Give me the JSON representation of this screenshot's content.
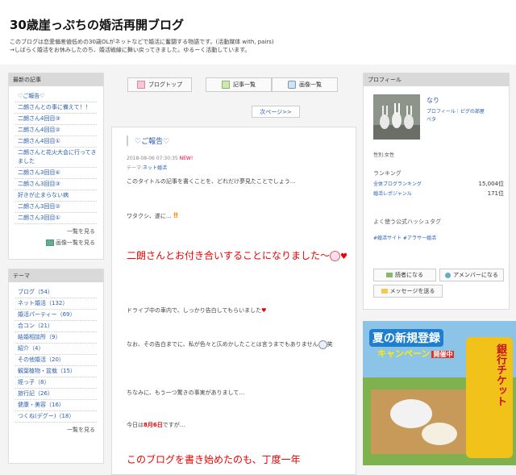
{
  "header": {
    "title": "30歳崖っぷちの婚活再開ブログ",
    "desc_1": "このブログは恋愛偏差値低めの30歳OLがネットなどで婚活に奮闘する物語です。(活動媒体 with, pairs)",
    "desc_2": "→しばらく婚活をお休みしたのち、婚活戦線に舞い戻ってきました。ゆるーく活動しています。"
  },
  "sidebar_recent": {
    "heading": "最新の記事",
    "items": [
      "♡ご報告♡",
      "二朗さんとの事に備えて！！",
      "二朗さん4回目③",
      "二朗さん4回目②",
      "二朗さん4回目①",
      "二朗さんと花火大会に行ってきました",
      "二朗さん3回目④",
      "二朗さん3回目③",
      "好きが止まらない病",
      "二朗さん3回目②",
      "二朗さん3回目①"
    ],
    "more_list": "一覧を見る",
    "more_images": "画像一覧を見る"
  },
  "sidebar_theme": {
    "heading": "テーマ",
    "items": [
      "ブログ（54）",
      "ネット婚活（132）",
      "婚活パーティー（69）",
      "合コン（21）",
      "結婚相談所（9）",
      "紹介（4）",
      "その他婚活（20）",
      "観葉植物・盆栽（15）",
      "姪っ子（8）",
      "旅行記（26）",
      "健康・美容（16）",
      "つくね(デグー)（18）"
    ],
    "more": "一覧を見る"
  },
  "nav": {
    "top": "ブログトップ",
    "list": "記事一覧",
    "images": "画像一覧",
    "next": "次ページ>>"
  },
  "article": {
    "title": "♡ご報告♡",
    "date": "2018-08-06 07:30:35",
    "new": "NEW!",
    "theme_label": "テーマ:",
    "theme": "ネット婚活",
    "p1": "このタイトルの記事を書くことを、どれだけ夢見たことでしょう…",
    "p2": "ワタクシ、遂に…",
    "big": "二朗さんとお付き合いすることになりました〜",
    "p3": "ドライブ中の車内で、しっかり告白してもらいました",
    "p4": "なお、その告白までに、私が色々と仄めかしたことは言うまでもありません",
    "p4_tail": "笑",
    "p5": "ちなみに、もう一つ驚きの事実がありまして…",
    "p6_pre": "今日は",
    "p6_red": "8月6日",
    "p6_post": "ですが…",
    "p7": "このブログを書き始めたのも、丁度一年"
  },
  "profile": {
    "heading": "プロフィール",
    "name": "なり",
    "links": "プロフィール｜ピグの部屋",
    "sub": "ペタ",
    "gender": "性別:女性",
    "ranking": "ランキング",
    "rank1_label": "全体ブログランキング",
    "rank1_val": "15,004位",
    "rank2_label": "婚活レポジャンル",
    "rank2_val": "171位",
    "hashtag_heading": "よく使う公式ハッシュタグ",
    "tags": "#婚活サイト #アラサー婚活",
    "reader_btn": "読者になる",
    "amember_btn": "アメンバーになる",
    "message_btn": "メッセージを送る"
  },
  "ad": {
    "line1": "夏の新規登録",
    "line2": "キャンペーン",
    "line3": "開催中",
    "badge": "銀行チケット"
  },
  "colors": {
    "accent": "#2a5db0",
    "red": "#e00000"
  }
}
